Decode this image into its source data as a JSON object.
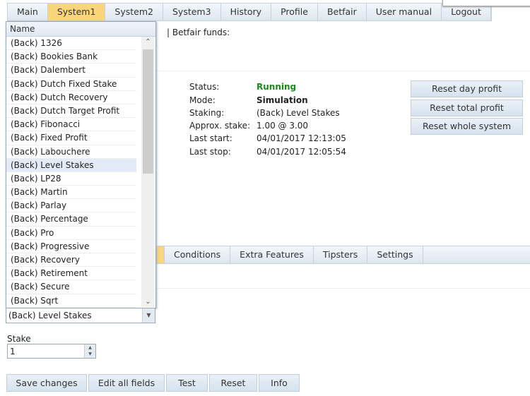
{
  "nav": {
    "tabs": [
      "Main",
      "System1",
      "System2",
      "System3",
      "History",
      "Profile",
      "Betfair",
      "User manual",
      "Logout"
    ],
    "active": "System1"
  },
  "header": {
    "funds_label": "| Betfair funds:"
  },
  "status": {
    "rows": [
      {
        "label": "Status:",
        "value": "Running"
      },
      {
        "label": "Mode:",
        "value": "Simulation"
      },
      {
        "label": "Staking:",
        "value": "(Back) Level Stakes"
      },
      {
        "label": "Approx. stake:",
        "value": "1.00 @ 3.00"
      },
      {
        "label": "Last start:",
        "value": "04/01/2017 12:13:05"
      },
      {
        "label": "Last stop:",
        "value": "04/01/2017 12:05:54"
      }
    ],
    "running_color": "#1a8a1a"
  },
  "actions": {
    "reset_day": "Reset day profit",
    "reset_total": "Reset total profit",
    "reset_system": "Reset whole system"
  },
  "subtabs": [
    "Conditions",
    "Extra Features",
    "Tipsters",
    "Settings"
  ],
  "dropdown": {
    "header": "Name",
    "selected": "(Back) Level Stakes",
    "items": [
      "(Back) 1326",
      "(Back) Bookies Bank",
      "(Back) Dalembert",
      "(Back) Dutch Fixed Stake",
      "(Back) Dutch Recovery",
      "(Back) Dutch Target Profit",
      "(Back) Fibonacci",
      "(Back) Fixed Profit",
      "(Back) Labouchere",
      "(Back) Level Stakes",
      "(Back) LP28",
      "(Back) Martin",
      "(Back) Parlay",
      "(Back) Percentage",
      "(Back) Pro",
      "(Back) Progressive",
      "(Back) Recovery",
      "(Back) Retirement",
      "(Back) Secure",
      "(Back) Sqrt"
    ]
  },
  "stake": {
    "label": "Stake",
    "value": "1"
  },
  "buttons": {
    "save": "Save changes",
    "edit": "Edit all fields",
    "test": "Test",
    "reset": "Reset",
    "info": "Info"
  }
}
